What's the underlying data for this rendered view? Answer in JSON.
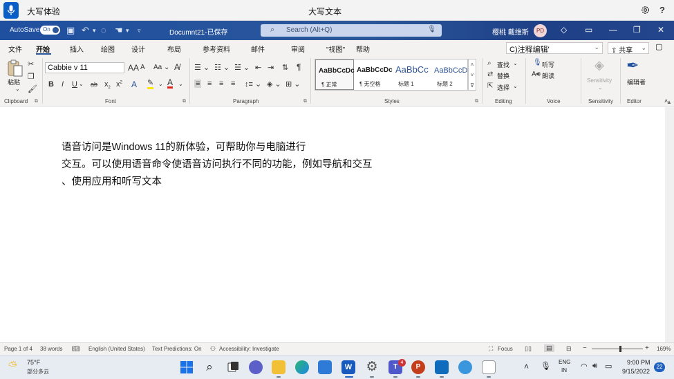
{
  "voice_bar": {
    "status": "大写体验",
    "heard": "大写文本",
    "help": "?"
  },
  "title_bar": {
    "autosave_label": "AutoSave",
    "toggle_state": "On",
    "document_title": "Documnt21-已保存",
    "search_placeholder": "Search (Alt+Q)",
    "user_name": "樱桃 戴维斯",
    "avatar_initials": "PD"
  },
  "tabs": [
    {
      "label": "文件"
    },
    {
      "label": "开始"
    },
    {
      "label": "插入"
    },
    {
      "label": "绘图"
    },
    {
      "label": "设计"
    },
    {
      "label": "布局"
    },
    {
      "label": "参考资料"
    },
    {
      "label": "邮件"
    },
    {
      "label": "审阅"
    },
    {
      "label": "\"视图\""
    },
    {
      "label": "帮助"
    }
  ],
  "command_box": "C)注释编辑'",
  "share_label": "共享",
  "ribbon": {
    "clipboard": {
      "paste_label": "粘贴",
      "group_label": "Clipboard"
    },
    "font": {
      "font_name": "Cabbie v 11",
      "grow": "A",
      "shrink": "A",
      "case": "Aa",
      "group_label": "Font",
      "bold": "B",
      "italic": "I",
      "underline": "U",
      "strike": "ab",
      "sub": "x",
      "sup": "x"
    },
    "paragraph": {
      "pilcrow": "¶",
      "group_label": "Paragraph"
    },
    "styles": {
      "items": [
        {
          "preview": "AaBbCcDc",
          "name": "¶ 正常"
        },
        {
          "preview": "AaBbCcDc",
          "name": "¶ 无空格"
        },
        {
          "preview": "AaBbCc",
          "name": "标题 1"
        },
        {
          "preview": "AaBbCcD",
          "name": "标题 2"
        }
      ],
      "group_label": "Styles"
    },
    "editing": {
      "find": "查找",
      "replace": "替换",
      "select": "选择",
      "group_label": "Editing"
    },
    "voice": {
      "dictate": "听写",
      "read_aloud": "朗读",
      "group_label": "Voice"
    },
    "sensitivity": {
      "label": "Sensitivity",
      "group_label": "Sensitivity"
    },
    "editor": {
      "label": "编辑者",
      "group_label": "Editor"
    }
  },
  "document": {
    "lines": [
      "语音访问是Windows 11的新体验，可帮助你与电脑进行",
      "交互。可以使用语音命令使语音访问执行不同的功能，例如导航和交互",
      "、使用应用和听写文本"
    ]
  },
  "status_bar": {
    "page": "Page 1 of 4",
    "words": "38 words",
    "language": "English (United States)",
    "predictions": "Text Predictions: On",
    "accessibility": "Accessibility: Investigate",
    "focus": "Focus",
    "zoom": "169%",
    "zoom_fraction": 0.55
  },
  "taskbar": {
    "temperature": "75°F",
    "weather": "部分多云",
    "teams_badge": "4",
    "lang_top": "ENG",
    "lang_bottom": "IN",
    "time": "9:00 PM",
    "date": "9/15/2022",
    "notifications": "22"
  },
  "colors": {
    "word_blue": "#2b579a",
    "voice_blue": "#0a5fc7",
    "taskbar": "#e7ecf2"
  }
}
